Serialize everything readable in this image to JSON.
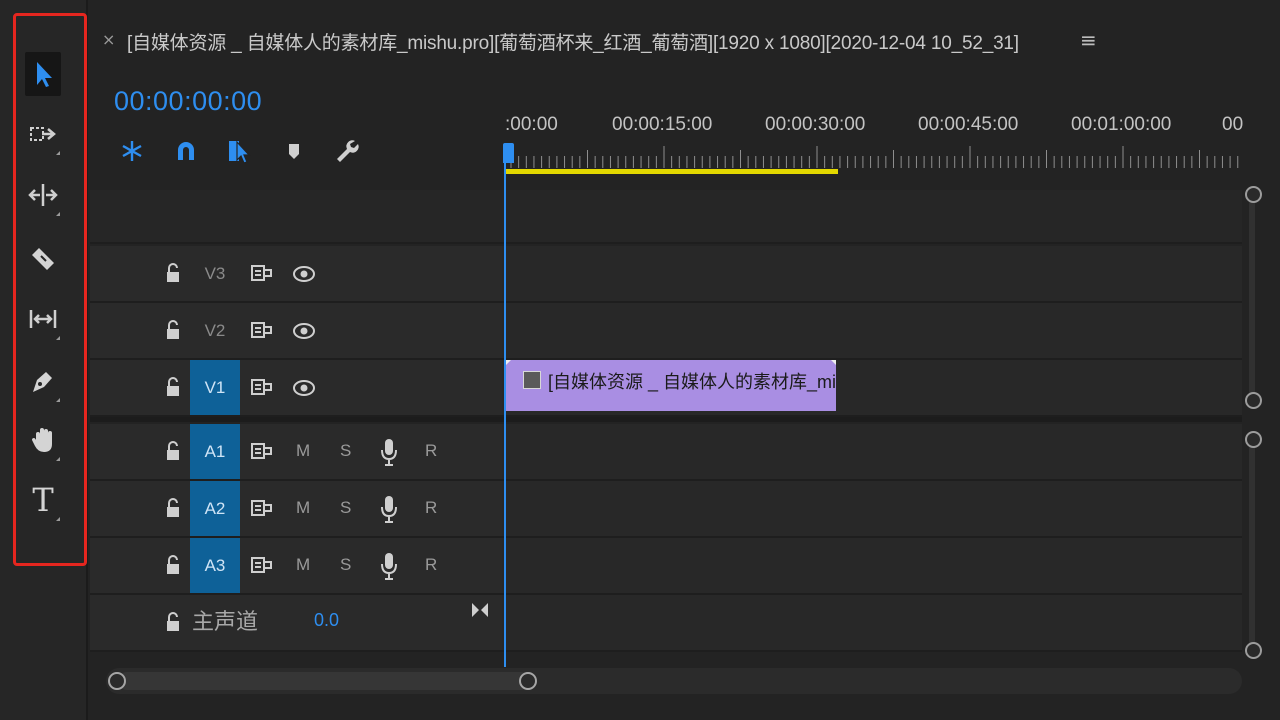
{
  "sequence": {
    "close": "×",
    "title": "[自媒体资源 _ 自媒体人的素材库_mishu.pro][葡萄酒杯来_红酒_葡萄酒][1920 x 1080][2020-12-04 10_52_31]",
    "menu": "≡",
    "timecode": "00:00:00:00"
  },
  "tools": [
    {
      "name": "selection-tool",
      "icon": "arrow-icon",
      "selected": true
    },
    {
      "name": "track-select-tool",
      "icon": "track-select-icon"
    },
    {
      "name": "ripple-edit-tool",
      "icon": "ripple-edit-icon"
    },
    {
      "name": "razor-tool",
      "icon": "razor-icon"
    },
    {
      "name": "slip-tool",
      "icon": "slip-icon"
    },
    {
      "name": "pen-tool",
      "icon": "pen-icon"
    },
    {
      "name": "hand-tool",
      "icon": "hand-icon"
    },
    {
      "name": "type-tool",
      "icon": "type-icon",
      "label": "T"
    }
  ],
  "ruler": {
    "labels": [
      ":00:00",
      "00:00:15:00",
      "00:00:30:00",
      "00:00:45:00",
      "00:01:00:00",
      "00"
    ]
  },
  "tracks": {
    "video": [
      {
        "name": "V3",
        "target": false
      },
      {
        "name": "V2",
        "target": false
      },
      {
        "name": "V1",
        "target": true
      }
    ],
    "audio": [
      {
        "name": "A1",
        "mute": "M",
        "solo": "S",
        "record": "R"
      },
      {
        "name": "A2",
        "mute": "M",
        "solo": "S",
        "record": "R"
      },
      {
        "name": "A3",
        "mute": "M",
        "solo": "S",
        "record": "R"
      }
    ],
    "master": {
      "label": "主声道",
      "value": "0.0"
    }
  },
  "clip": {
    "label": "[自媒体资源 _ 自媒体人的素材库_mi"
  },
  "colors": {
    "accent": "#2e8ef0",
    "clip": "#a98ee3",
    "workarea": "#e3d800",
    "highlight": "#e5261f",
    "track_target": "#0e6198"
  }
}
